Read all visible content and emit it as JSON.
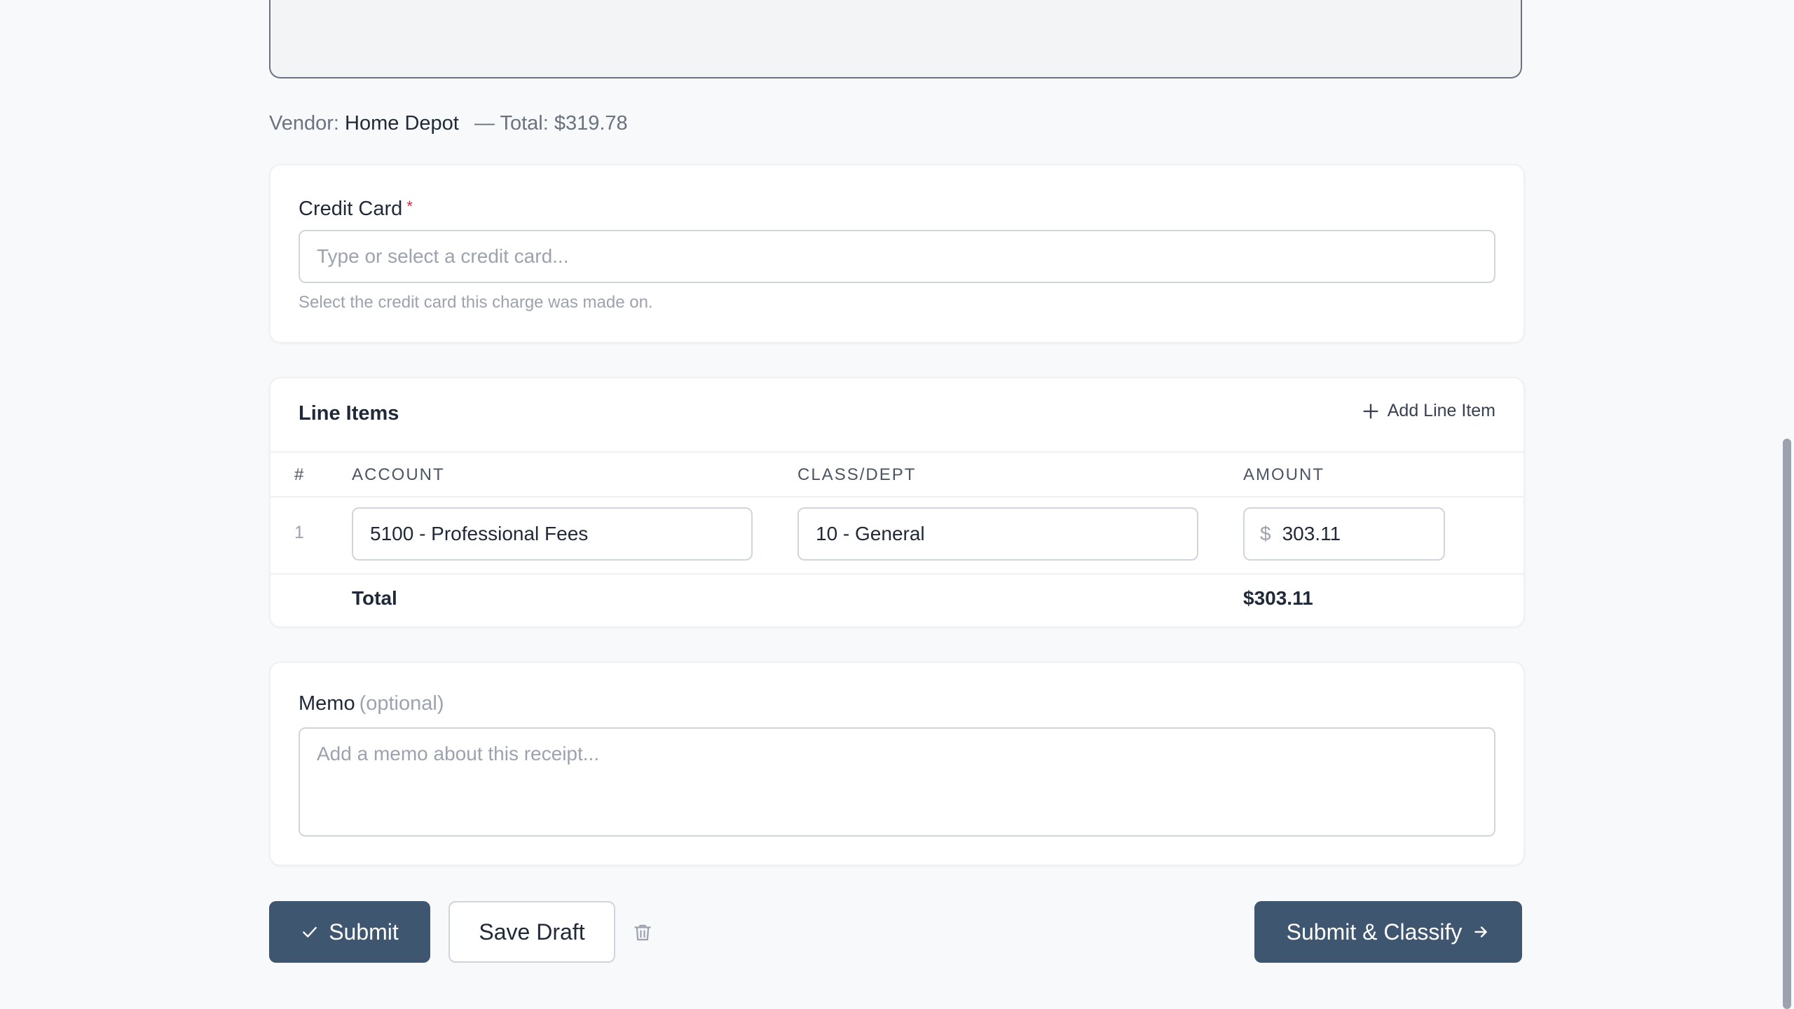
{
  "receipt": {
    "vendor_label": "Vendor:",
    "vendor_name": "Home Depot",
    "total_text": "— Total: $319.78"
  },
  "credit_card": {
    "label": "Credit Card",
    "required_mark": "*",
    "placeholder": "Type or select a credit card...",
    "help": "Select the credit card this charge was made on."
  },
  "line_items": {
    "title": "Line Items",
    "add_label": "Add Line Item",
    "columns": [
      "#",
      "Account",
      "Class/Dept",
      "Amount"
    ],
    "rows": [
      {
        "num": "1",
        "account": "5100 - Professional Fees",
        "class": "10 - General",
        "currency": "$",
        "amount": "303.11"
      }
    ],
    "total_label": "Total",
    "total_value": "$303.11"
  },
  "memo": {
    "label": "Memo",
    "optional": "(optional)",
    "placeholder": "Add a memo about this receipt..."
  },
  "actions": {
    "submit_label": "Submit",
    "draft_label": "Save Draft",
    "classify_label": "Submit & Classify"
  },
  "icons": {
    "submit": "check-icon",
    "add": "plus-icon",
    "delete": "trash-icon",
    "classify": "arrow-right-icon"
  },
  "colors": {
    "primary": "#3e5670",
    "required": "#e11d48"
  }
}
